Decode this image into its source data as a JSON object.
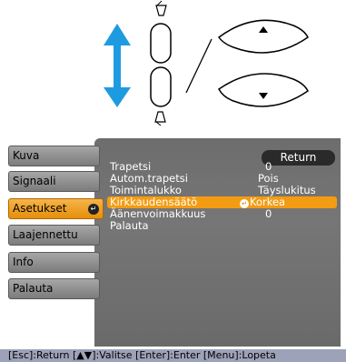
{
  "menu": {
    "items": [
      {
        "label": "Kuva",
        "active": false
      },
      {
        "label": "Signaali",
        "active": false
      },
      {
        "label": "Asetukset",
        "active": true
      },
      {
        "label": "Laajennettu",
        "active": false
      },
      {
        "label": "Info",
        "active": false
      },
      {
        "label": "Palauta",
        "active": false
      }
    ]
  },
  "panel": {
    "return_label": "Return",
    "rows": [
      {
        "label": "Trapetsi",
        "value": "0"
      },
      {
        "label": "Autom.trapetsi",
        "value": "Pois"
      },
      {
        "label": "Toimintalukko",
        "value": "Täyslukitus"
      },
      {
        "label": "Kirkkaudensäätö",
        "value": "Korkea",
        "active": true
      },
      {
        "label": "Äänenvoimakkuus",
        "value": "0"
      },
      {
        "label": "Palauta",
        "value": ""
      }
    ]
  },
  "footer": {
    "text": "[Esc]:Return [▲▼]:Valitse [Enter]:Enter  [Menu]:Lopeta"
  },
  "colors": {
    "accent": "#f39c12",
    "panel_bg": "#6f6f6f",
    "menu_bg": "#8e8e8e",
    "footer_bg": "#9ea2b8",
    "arrow_blue": "#1e9be0"
  }
}
